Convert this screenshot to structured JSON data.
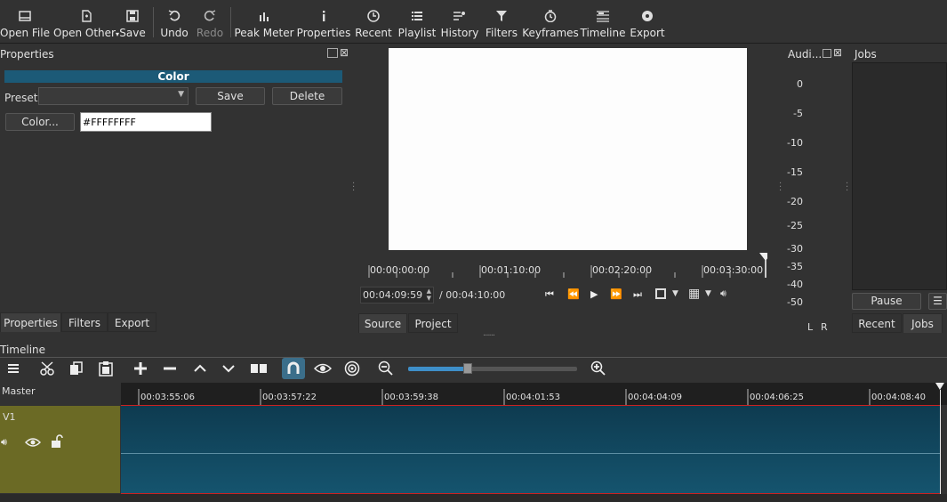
{
  "toolbar": {
    "open_file": "Open File",
    "open_other": "Open Other",
    "save": "Save",
    "undo": "Undo",
    "redo": "Redo",
    "peak_meter": "Peak Meter",
    "properties": "Properties",
    "recent": "Recent",
    "playlist": "Playlist",
    "history": "History",
    "filters": "Filters",
    "keyframes": "Keyframes",
    "timeline": "Timeline",
    "export": "Export"
  },
  "properties_panel": {
    "title": "Properties",
    "section_title": "Color",
    "preset_label": "Preset",
    "preset_value": "",
    "save_label": "Save",
    "delete_label": "Delete",
    "color_button": "Color...",
    "color_value": "#FFFFFFFF",
    "tabs": [
      "Properties",
      "Filters",
      "Export"
    ]
  },
  "player": {
    "ruler_ticks": [
      "00:00:00:00",
      "00:01:10:00",
      "00:02:20:00",
      "00:03:30:00"
    ],
    "current_time": "00:04:09:59",
    "total_time": "/ 00:04:10:00",
    "tabs": [
      "Source",
      "Project"
    ]
  },
  "audio_meter": {
    "title": "Audi...",
    "scale": [
      "0",
      "-5",
      "-10",
      "-15",
      "-20",
      "-25",
      "-30",
      "-35",
      "-40",
      "-45",
      "-50"
    ],
    "left": "L",
    "right": "R"
  },
  "jobs_panel": {
    "title": "Jobs",
    "pause_label": "Pause",
    "tabs": [
      "Recent",
      "Jobs"
    ]
  },
  "timeline": {
    "title": "Timeline",
    "master_label": "Master",
    "track_label": "V1",
    "ruler_ticks": [
      "00:03:55:06",
      "00:03:57:22",
      "00:03:59:38",
      "00:04:01:53",
      "00:04:04:09",
      "00:04:06:25",
      "00:04:08:40"
    ],
    "zoom_level": 0.35
  },
  "colors": {
    "accent_header": "#1c5a77",
    "clip": "#15546e",
    "track_header": "#6b6a25",
    "playhead": "#cc0000"
  }
}
